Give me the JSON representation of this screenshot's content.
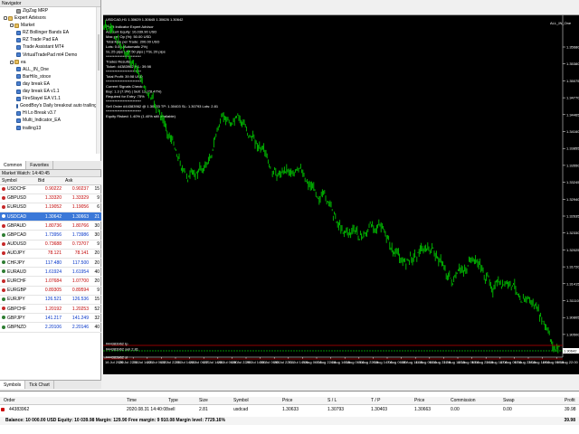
{
  "navigator": {
    "title": "Navigator",
    "items": [
      {
        "label": "ZigZag MRP",
        "type": "ind",
        "level": 2
      },
      {
        "label": "Expert Advisors",
        "type": "folder",
        "level": 0
      },
      {
        "label": "Market",
        "type": "folder",
        "level": 1
      },
      {
        "label": "RZ Bollinger Bands EA",
        "type": "ea",
        "level": 2
      },
      {
        "label": "RZ Trade Pad EA",
        "type": "ea",
        "level": 2
      },
      {
        "label": "Trade Assistant MT4",
        "type": "ea",
        "level": 2
      },
      {
        "label": "VirtualTradePad mt4 Demo",
        "type": "ea",
        "level": 2
      },
      {
        "label": "ea",
        "type": "folder",
        "level": 1
      },
      {
        "label": "ALL_IN_One",
        "type": "ea",
        "level": 2
      },
      {
        "label": "BarHilo_stoce",
        "type": "ea",
        "level": 2
      },
      {
        "label": "day break EA",
        "type": "ea",
        "level": 2
      },
      {
        "label": "day break EA v1.1",
        "type": "ea",
        "level": 2
      },
      {
        "label": "FireStayel EA V1.1",
        "type": "ea",
        "level": 2
      },
      {
        "label": "GoodBoy's Daily breakout auto trailing rob",
        "type": "ea",
        "level": 2
      },
      {
        "label": "Hi Lo Break v3.7",
        "type": "ea",
        "level": 2
      },
      {
        "label": "Multi_Indicator_EA",
        "type": "ea",
        "level": 2
      },
      {
        "label": "trailing13",
        "type": "ea",
        "level": 2
      }
    ],
    "tabs": [
      "Common",
      "Favorites"
    ]
  },
  "market_watch": {
    "title": "Market Watch: 14:40:45",
    "columns": [
      "Symbol",
      "Bid",
      "Ask",
      ""
    ],
    "rows": [
      {
        "symbol": "USDCHF",
        "bid": "0.90222",
        "ask": "0.90237",
        "spread": "15",
        "dir": "dn"
      },
      {
        "symbol": "GBPUSD",
        "bid": "1.33320",
        "ask": "1.33329",
        "spread": "9",
        "dir": "dn"
      },
      {
        "symbol": "EURUSD",
        "bid": "1.19052",
        "ask": "1.19056",
        "spread": "6",
        "dir": "dn"
      },
      {
        "symbol": "USDCAD",
        "bid": "1.30642",
        "ask": "1.30663",
        "spread": "21",
        "dir": "sel"
      },
      {
        "symbol": "GBPAUD",
        "bid": "1.80736",
        "ask": "1.80766",
        "spread": "30",
        "dir": "dn"
      },
      {
        "symbol": "GBPCAD",
        "bid": "1.73956",
        "ask": "1.73986",
        "spread": "30",
        "dir": "up"
      },
      {
        "symbol": "AUDUSD",
        "bid": "0.73688",
        "ask": "0.73707",
        "spread": "9",
        "dir": "dn"
      },
      {
        "symbol": "AUDJPY",
        "bid": "78.121",
        "ask": "78.141",
        "spread": "20",
        "dir": "dn"
      },
      {
        "symbol": "CHFJPY",
        "bid": "117.480",
        "ask": "117.500",
        "spread": "20",
        "dir": "up"
      },
      {
        "symbol": "EURAUD",
        "bid": "1.61924",
        "ask": "1.61954",
        "spread": "40",
        "dir": "up"
      },
      {
        "symbol": "EURCHF",
        "bid": "1.07684",
        "ask": "1.07700",
        "spread": "20",
        "dir": "dn"
      },
      {
        "symbol": "EURGBP",
        "bid": "0.89305",
        "ask": "0.89594",
        "spread": "9",
        "dir": "dn"
      },
      {
        "symbol": "EURJPY",
        "bid": "126.521",
        "ask": "126.536",
        "spread": "15",
        "dir": "up"
      },
      {
        "symbol": "GBPCHF",
        "bid": "1.20192",
        "ask": "1.20253",
        "spread": "52",
        "dir": "dn"
      },
      {
        "symbol": "GBPJPY",
        "bid": "141.217",
        "ask": "141.249",
        "spread": "32",
        "dir": "up"
      },
      {
        "symbol": "GBPNZD",
        "bid": "2.20106",
        "ask": "2.20146",
        "spread": "40",
        "dir": "up"
      }
    ],
    "tabs": [
      "Symbols",
      "Tick Chart"
    ]
  },
  "chart": {
    "header": "USDCAD,H1  1.30629 1.30645 1.30626 1.30642",
    "symbol_label": "ALL_IN_One",
    "info_lines": [
      "Profit Indicator Expert Advisor",
      "Account Equity: 10,039.90 USD",
      "Max per Op (%): 50.00 USD",
      "Total Max per Trade: 200.00 USD",
      "Lots: 0.00 (Automatic 2%)",
      "SL:25 pips | TP:50 pips | TSL:20 pips",
      "*************************",
      "Trades Results:",
      "Ticket: 44383962 P/L: 39.98",
      "*************************",
      "Total Profit: 39.98 USD",
      "*************************",
      "Current Signals Check:",
      "Buy: 1.3 (7.9%) | Sell: 13 (78.47%)",
      "Required for Entry: 75%",
      "*************************",
      "Sell Order #44383962 @ 1.30633 TP: 1.30403 SL: 1.30793 Lots: 2.81",
      "*************************",
      "Equity Risked: 1.40% (1.40% still available)"
    ],
    "order_lines": [
      "#44383962 tp",
      "#44383962 sell 2.81",
      "#44383962 sl"
    ],
    "price_ticks": [
      "1.35680",
      "1.35380",
      "1.35075",
      "1.34770",
      "1.34465",
      "1.34160",
      "1.33855",
      "1.33550",
      "1.33245",
      "1.32940",
      "1.32635",
      "1.32330",
      "1.32025",
      "1.31720",
      "1.31415",
      "1.31110",
      "1.30805",
      "1.30500",
      "1.30195"
    ],
    "current_price": "1.30642",
    "time_ticks": [
      "16 Jul 2020",
      "20 Jul 22:00",
      "21 Jul 14:00",
      "22 Jul 06:00",
      "22 Jul 22:00",
      "23 Jul 14:00",
      "24 Jul 06:00",
      "27 Jul 14:00",
      "28 Jul 06:00",
      "28 Jul 22:00",
      "29 Jul 14:00",
      "30 Jul 06:00",
      "30 Jul 22:00",
      "31 Jul 14:00",
      "3 Aug 06:00",
      "3 Aug 22:00",
      "4 Aug 14:00",
      "5 Aug 06:00",
      "5 Aug 22:00",
      "6 Aug 14:00",
      "7 Aug 06:00",
      "10 Aug 14:00",
      "11 Aug 06:00",
      "11 Aug 22:00",
      "12 Aug 14:00",
      "13 Aug 06:00",
      "13 Aug 22:00",
      "14 Aug 14:00",
      "17 Aug 06:00",
      "17 Aug 22:00",
      "18 Aug 14:00",
      "19 Aug 06:00",
      "19 Aug 22:00"
    ],
    "candle_color": "#00c000",
    "background": "#000000",
    "tp_line_color": "#c00000",
    "sl_line_color": "#c00000",
    "entry_line_color": "#00c000"
  },
  "terminal": {
    "headers": [
      "Order",
      "Time",
      "Type",
      "Size",
      "Symbol",
      "Price",
      "S / L",
      "T / P",
      "Price",
      "Commission",
      "Swap",
      "Profit"
    ],
    "row": [
      "44383962",
      "2020.08.31 14:40:08",
      "sell",
      "2.81",
      "usdcad",
      "1.30633",
      "1.30793",
      "1.30403",
      "1.30663",
      "0.00",
      "0.00",
      "39.98"
    ],
    "balance": "Balance: 10 000.00 USD  Equity: 10 039.98  Margin: 129.90  Free margin: 9 910.08  Margin level: 7729.16%",
    "balance_profit": "39.98"
  }
}
